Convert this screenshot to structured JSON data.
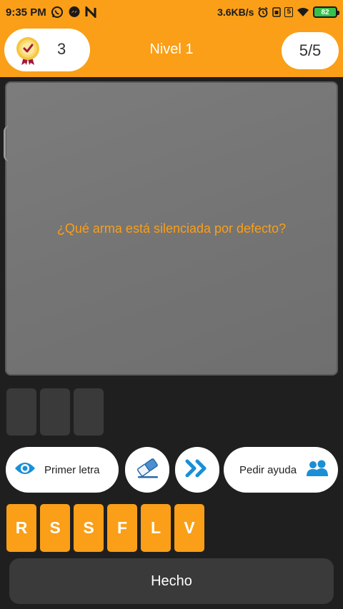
{
  "status_bar": {
    "time": "9:35 PM",
    "left_icons": [
      "whatsapp-icon",
      "messenger-icon",
      "n-app-icon"
    ],
    "network_speed": "3.6KB/s",
    "sim_label": "5",
    "battery": "82",
    "right_icons": [
      "alarm-icon",
      "sim-icon",
      "wifi-icon",
      "battery-icon"
    ]
  },
  "header": {
    "score": "3",
    "level_title": "Nivel 1",
    "progress": "5/5",
    "medal_icon": "medal-icon"
  },
  "question": {
    "text": "¿Qué arma está silenciada por defecto?"
  },
  "answer": {
    "slot_count": 3
  },
  "actions": {
    "first_letter_label": "Primer letra",
    "help_label": "Pedir ayuda",
    "icons": {
      "first_letter": "eye-icon",
      "erase": "eraser-icon",
      "skip": "skip-forward-icon",
      "help": "people-icon"
    }
  },
  "letters": [
    "R",
    "S",
    "S",
    "F",
    "L",
    "V"
  ],
  "done_label": "Hecho",
  "colors": {
    "accent": "#fa9f17",
    "background": "#1f1f1f",
    "card": "#777777",
    "icon_blue": "#1a8fd6"
  }
}
